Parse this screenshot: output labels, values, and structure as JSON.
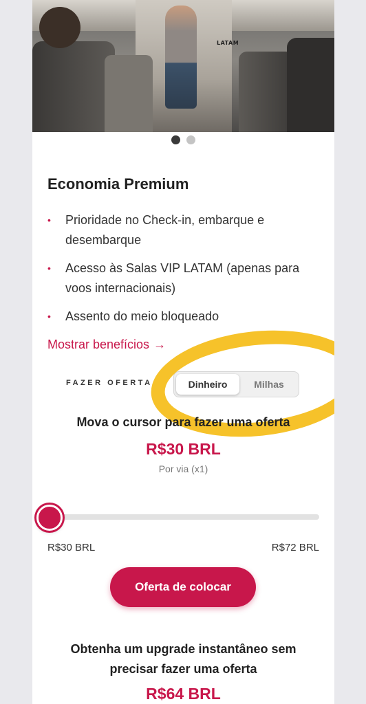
{
  "hero": {
    "image_description": "cabin photo",
    "sign_text": "LATAM"
  },
  "carousel": {
    "dots": [
      {
        "active": true
      },
      {
        "active": false
      }
    ]
  },
  "cabin": {
    "title": "Economia Premium",
    "benefits": [
      "Prioridade no Check-in, embarque e desembarque",
      "Acesso às Salas VIP LATAM (apenas para voos internacionais)",
      "Assento do meio bloqueado"
    ],
    "show_more": "Mostrar benefícios",
    "show_more_arrow": "→"
  },
  "offer": {
    "label": "FAZER OFERTA E",
    "toggle": {
      "selected": "Dinheiro",
      "options": [
        "Dinheiro",
        "Milhas"
      ]
    },
    "instruction": "Mova o cursor para fazer uma oferta",
    "price": "R$30 BRL",
    "per": "Por via (x1)",
    "slider": {
      "min": "R$30 BRL",
      "max": "R$72 BRL",
      "value_fraction": 0.0
    },
    "button": "Oferta de colocar"
  },
  "upgrade": {
    "text": "Obtenha um upgrade instantâneo sem precisar fazer uma oferta",
    "price": "R$64 BRL"
  },
  "colors": {
    "accent": "#c8174b",
    "highlight": "#f6c22a"
  }
}
